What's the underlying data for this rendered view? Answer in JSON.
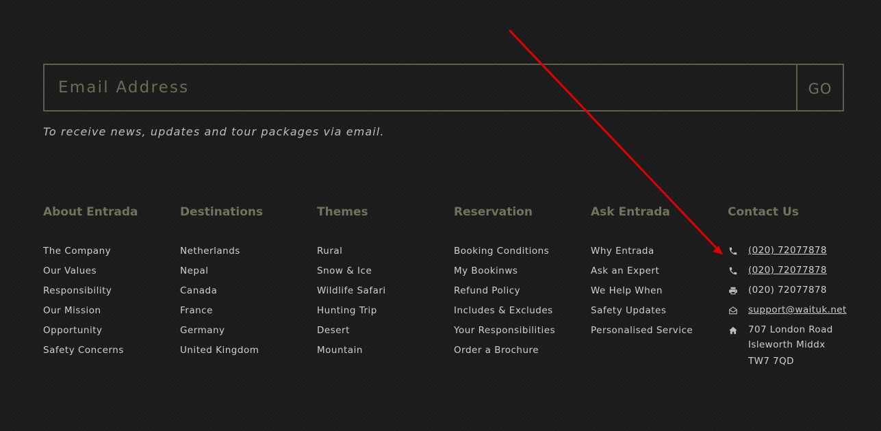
{
  "newsletter": {
    "placeholder": "Email Address",
    "go_label": "GO",
    "note": "To receive news, updates and tour packages via email."
  },
  "columns": [
    {
      "heading": "About Entrada",
      "items": [
        "The Company",
        "Our Values",
        "Responsibility",
        "Our Mission",
        "Opportunity",
        "Safety Concerns"
      ]
    },
    {
      "heading": "Destinations",
      "items": [
        "Netherlands",
        "Nepal",
        "Canada",
        "France",
        "Germany",
        "United Kingdom"
      ]
    },
    {
      "heading": "Themes",
      "items": [
        "Rural",
        "Snow & Ice",
        "Wildlife Safari",
        "Hunting Trip",
        "Desert",
        "Mountain"
      ]
    },
    {
      "heading": "Reservation",
      "items": [
        "Booking Conditions",
        "My Bookinws",
        "Refund Policy",
        "Includes & Excludes",
        "Your Responsibilities",
        "Order a Brochure"
      ]
    },
    {
      "heading": "Ask Entrada",
      "items": [
        "Why Entrada",
        "Ask an Expert",
        "We Help When",
        "Safety Updates",
        "Personalised Service"
      ]
    }
  ],
  "contact": {
    "heading": "Contact Us",
    "phone1": {
      "icon": "phone-icon",
      "text": "(020) 72077878"
    },
    "phone2": {
      "icon": "phone-icon",
      "text": "(020) 72077878"
    },
    "fax": {
      "icon": "fax-icon",
      "text": "(020) 72077878"
    },
    "email": {
      "icon": "envelope-icon",
      "text": "support@waituk.net"
    },
    "address": {
      "icon": "home-icon",
      "lines": [
        "707 London Road",
        "Isleworth Middx",
        "TW7 7QD"
      ]
    }
  },
  "colors": {
    "background": "#1c1c1c",
    "heading": "#72725e",
    "link": "#cfcfcf",
    "border": "#5f5f4c",
    "annotation_arrow": "#e00000"
  }
}
